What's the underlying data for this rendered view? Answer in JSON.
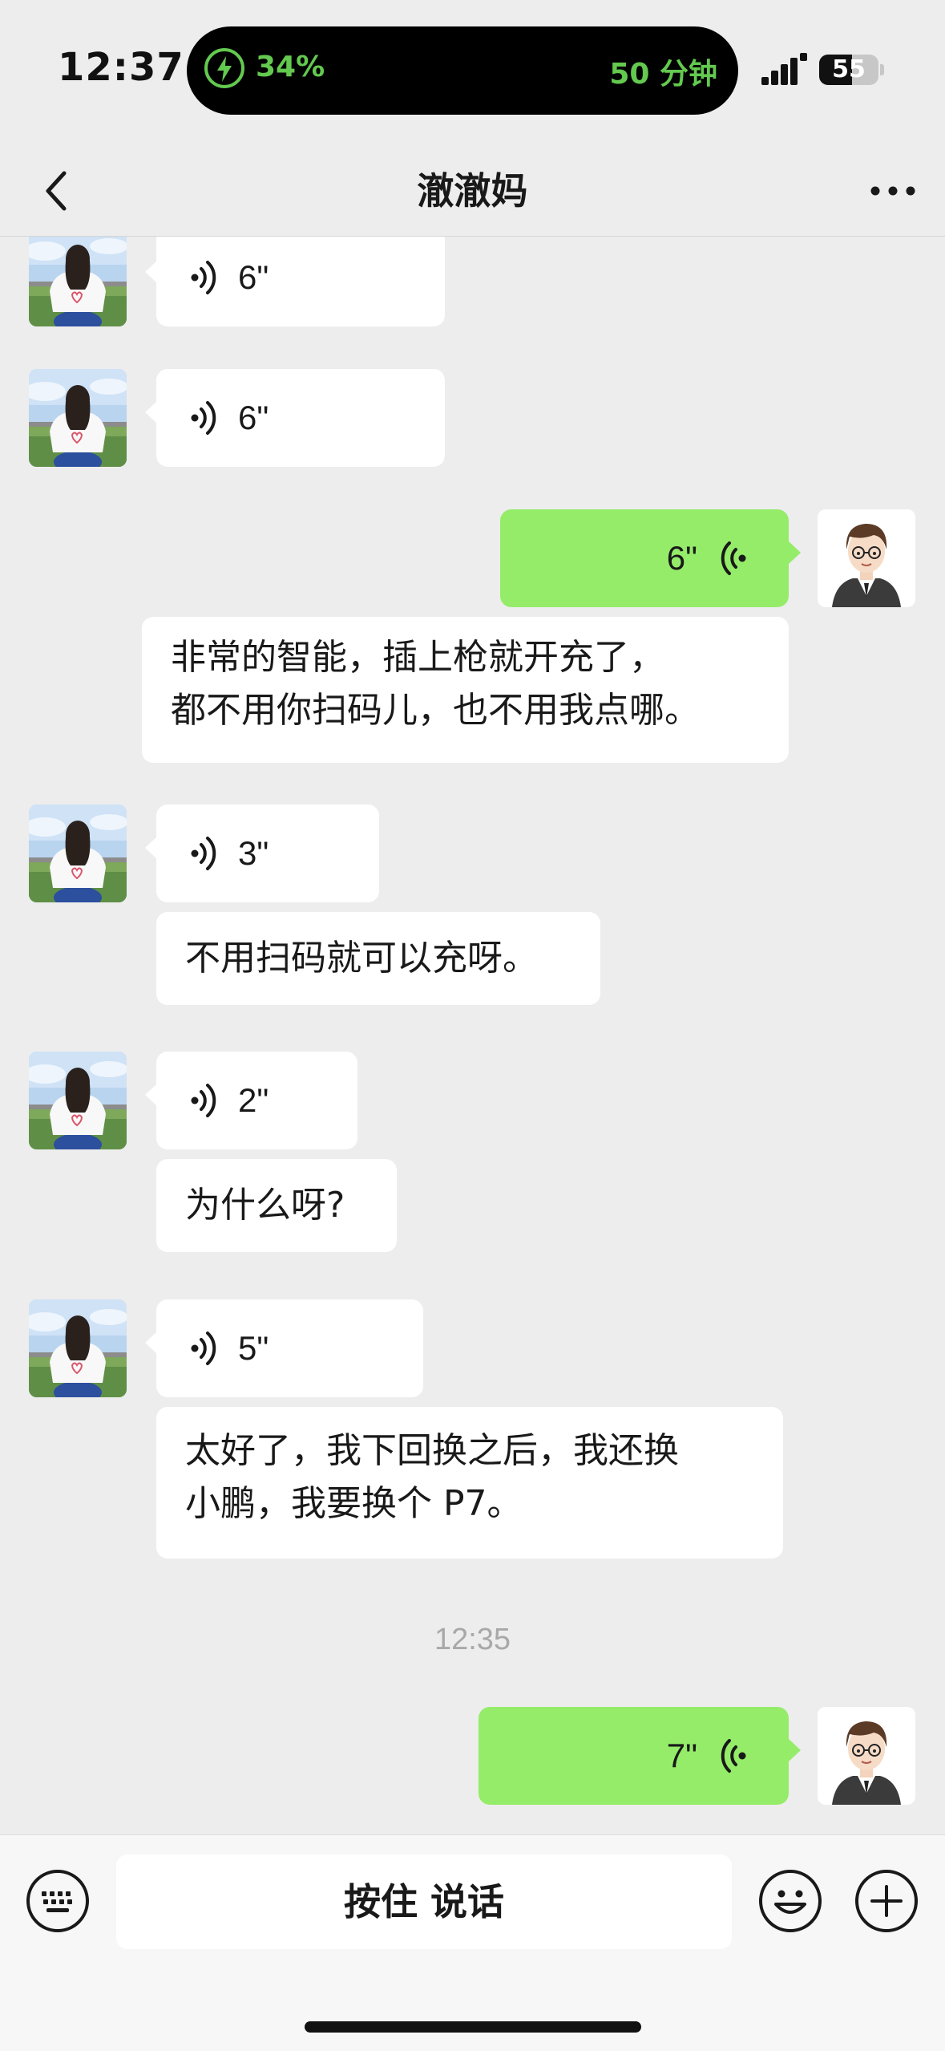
{
  "status_bar": {
    "time": "12:37",
    "battery_percent_label": "34%",
    "minutes_label": "50 分钟",
    "battery_number": "55",
    "battery_level": 0.55
  },
  "nav": {
    "title": "澈澈妈",
    "back_icon": "chevron-left-icon",
    "more_icon": "ellipsis-icon"
  },
  "messages": [
    {
      "sender": "other",
      "type": "voice",
      "duration": "6\""
    },
    {
      "sender": "other",
      "type": "voice",
      "duration": "6\""
    },
    {
      "sender": "me",
      "type": "voice",
      "duration": "6\"",
      "transcript": [
        "非常的智能，插上枪就开充了，",
        "都不用你扫码儿，也不用我点哪。"
      ]
    },
    {
      "sender": "other",
      "type": "voice",
      "duration": "3\"",
      "transcript": [
        "不用扫码就可以充呀。"
      ]
    },
    {
      "sender": "other",
      "type": "voice",
      "duration": "2\"",
      "transcript": [
        "为什么呀?"
      ]
    },
    {
      "sender": "other",
      "type": "voice",
      "duration": "5\"",
      "transcript": [
        "太好了，我下回换之后，我还换",
        "小鹏，我要换个 P7。"
      ]
    },
    {
      "type": "timestamp",
      "text": "12:35"
    },
    {
      "sender": "me",
      "type": "voice",
      "duration": "7\""
    }
  ],
  "input_bar": {
    "hold_to_talk_label": "按住 说话",
    "keyboard_icon": "keyboard-icon",
    "emoji_icon": "emoji-icon",
    "plus_icon": "plus-icon"
  },
  "colors": {
    "chat_background": "#ededed",
    "my_bubble": "#95ec69",
    "other_bubble": "#ffffff",
    "charging_green": "#63c94f"
  }
}
